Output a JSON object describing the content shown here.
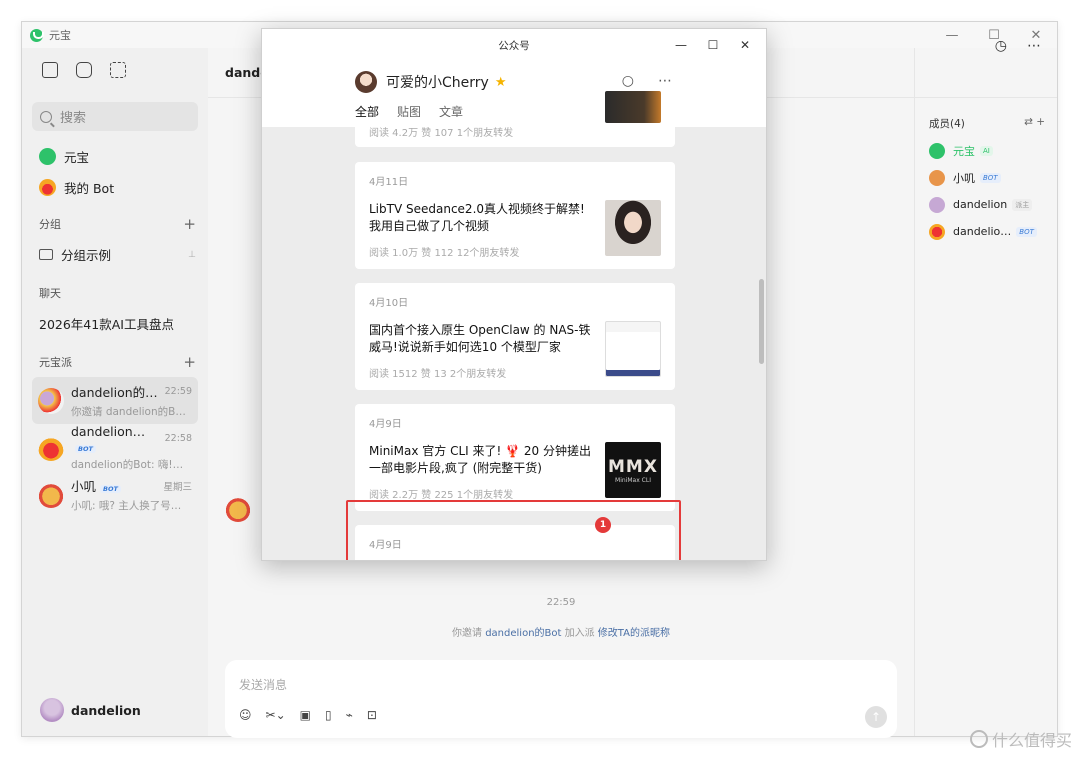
{
  "app": {
    "title": "元宝"
  },
  "sidebar": {
    "search_placeholder": "搜索",
    "top_items": [
      {
        "label": "元宝"
      },
      {
        "label": "我的 Bot"
      }
    ],
    "group_header": "分组",
    "group_item": "分组示例",
    "chat_header": "聊天",
    "chat_item": "2026年41款AI工具盘点",
    "yuanbao_header": "元宝派",
    "chats": [
      {
        "name": "dandelion的…",
        "time": "22:59",
        "preview": "你邀请 dandelion的Bo…"
      },
      {
        "name": "dandelion…",
        "badge": "BOT",
        "time": "22:58",
        "preview": "dandelion的Bot: 嗨!…"
      },
      {
        "name": "小叽",
        "badge": "BOT",
        "time": "星期三",
        "preview": "小叽: 哦? 主人换了号…"
      }
    ],
    "user": "dandelion"
  },
  "main": {
    "header_title": "dande",
    "system_time": "22:59",
    "system_note": {
      "prefix": "你邀请 ",
      "bot": "dandelion的Bot",
      "middle": " 加入派 ",
      "link": "修改TA的派昵称"
    },
    "composer_placeholder": "发送消息"
  },
  "members": {
    "title": "成员(4)",
    "list": [
      {
        "name": "元宝",
        "role": "AI",
        "role_color": "#2ec26a"
      },
      {
        "name": "小叽",
        "role": "BOT",
        "role_color": "#3a7bd5"
      },
      {
        "name": "dandelion",
        "role": "派主",
        "role_color": "#999999"
      },
      {
        "name": "dandelio…",
        "role": "BOT",
        "role_color": "#3a7bd5"
      }
    ]
  },
  "popup": {
    "window_title": "公众号",
    "account": "可爱的小Cherry",
    "tabs": [
      "全部",
      "贴图",
      "文章"
    ],
    "cards": [
      {
        "date": "",
        "title": "",
        "meta": "阅读 4.2万  赞 107  1个朋友转发"
      },
      {
        "date": "4月11日",
        "title": "LibTV Seedance2.0真人视频终于解禁!我用自己做了几个视频",
        "meta": "阅读 1.0万  赞 112  12个朋友转发"
      },
      {
        "date": "4月10日",
        "title": "国内首个接入原生 OpenClaw 的 NAS-铁威马!说说新手如何选10 个模型厂家",
        "meta": "阅读 1512  赞 13  2个朋友转发"
      },
      {
        "date": "4月9日",
        "title": "MiniMax 官方 CLI 来了! 🦞 20 分钟搓出一部电影片段,疯了 (附完整干货)",
        "meta": "阅读 2.2万  赞 225  1个朋友转发",
        "thumb_text": "MMX",
        "thumb_sub": "MiniMax CLI"
      },
      {
        "date": "4月9日",
        "title": "",
        "meta": ""
      }
    ],
    "highlight_badge": "1"
  },
  "watermark": "什么值得买"
}
